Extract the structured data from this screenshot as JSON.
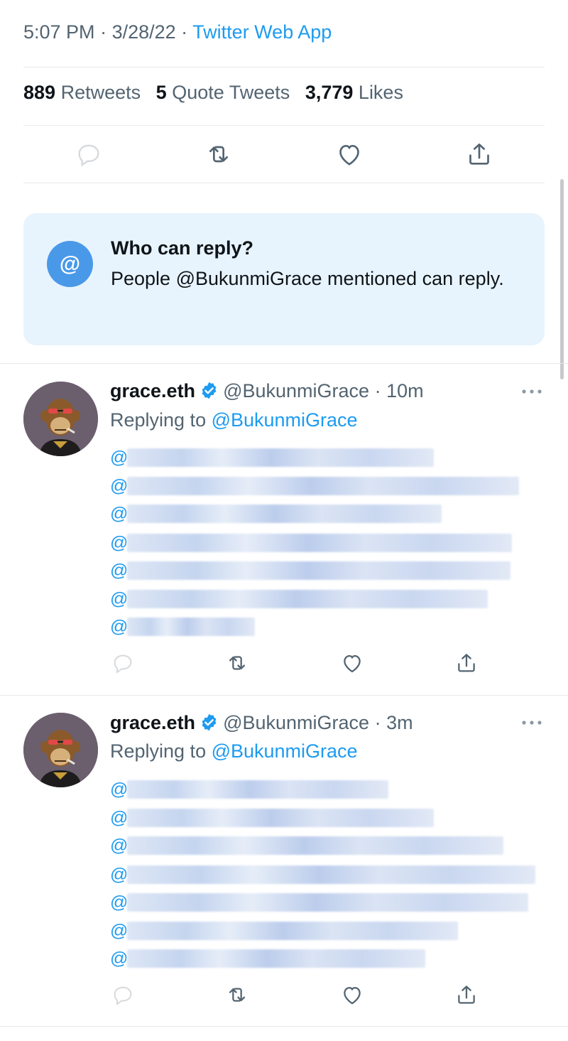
{
  "tweet_meta": {
    "time": "5:07 PM",
    "sep1": " · ",
    "date": "3/28/22",
    "sep2": " · ",
    "app": "Twitter Web App"
  },
  "stats": {
    "retweets_count": "889",
    "retweets_label": "Retweets",
    "quotes_count": "5",
    "quotes_label": "Quote Tweets",
    "likes_count": "3,779",
    "likes_label": "Likes"
  },
  "actions": {
    "icons": [
      "reply-icon",
      "retweet-icon",
      "like-icon",
      "share-icon"
    ]
  },
  "reply_restriction": {
    "icon_glyph": "@",
    "title": "Who can reply?",
    "body": "People @BukunmiGrace mentioned can reply."
  },
  "replies": [
    {
      "name": "grace.eth",
      "handle": "@BukunmiGrace",
      "dot": "·",
      "time": "10m",
      "replying_prefix": "Replying to ",
      "replying_to": "@BukunmiGrace",
      "mention_prefix": "@",
      "mentions_blurred": 7
    },
    {
      "name": "grace.eth",
      "handle": "@BukunmiGrace",
      "dot": "·",
      "time": "3m",
      "replying_prefix": "Replying to ",
      "replying_to": "@BukunmiGrace",
      "mention_prefix": "@",
      "mentions_blurred": 7
    }
  ],
  "colors": {
    "accent": "#1d9bf0",
    "secondary_text": "#536471",
    "card_bg": "#e8f4fd",
    "badge": "#4a99e9"
  }
}
